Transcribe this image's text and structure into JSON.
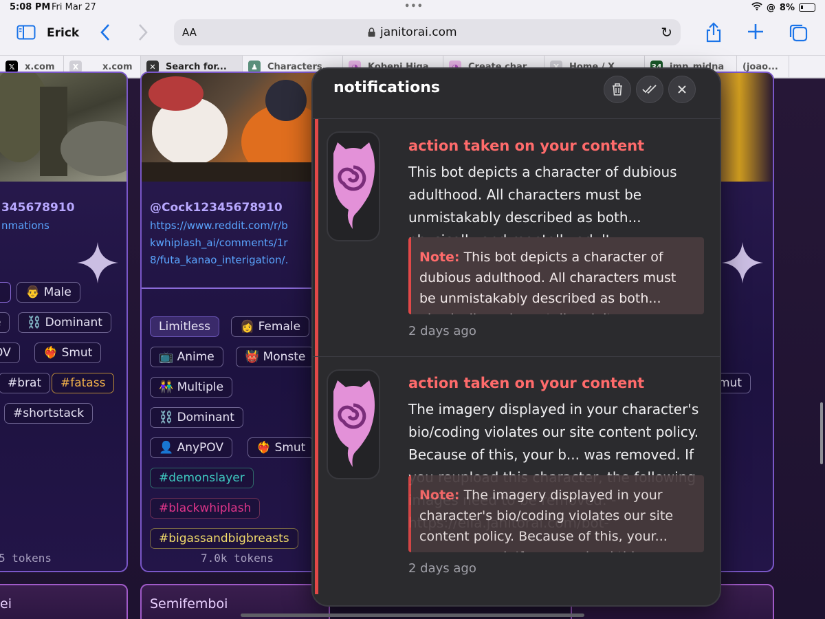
{
  "status": {
    "time": "5:08 PM",
    "date": "Fri Mar 27",
    "battery": "8%"
  },
  "toolbar": {
    "profile": "Erick",
    "text_size": "AA",
    "url": "janitorai.com"
  },
  "tabs": [
    {
      "label": "x.com",
      "icon": "x-logo-icon"
    },
    {
      "label": "x.com",
      "icon": "x-logo-icon"
    },
    {
      "label": "Search for...",
      "icon": "x-logo-icon"
    },
    {
      "label": "Characters...",
      "icon": "character-icon"
    },
    {
      "label": "Kobeni Higa...",
      "icon": "pink-blob-icon"
    },
    {
      "label": "Create char...",
      "icon": "pink-blob-icon"
    },
    {
      "label": "Home / X",
      "icon": "x-logo-icon"
    },
    {
      "label": "imp_midna",
      "icon": "34-icon"
    },
    {
      "label": "(joao...",
      "icon": ""
    }
  ],
  "cards": {
    "left": {
      "handle": "345678910",
      "link": "nmations",
      "tags": [
        "👨 Male",
        "e",
        "⛓️ Dominant",
        "OV",
        "❤️‍🔥 Smut",
        "#brat",
        "#fatass",
        "#shortstack"
      ],
      "tokens": "5 tokens",
      "bottom": "ei"
    },
    "middle": {
      "handle": "@Cock12345678910",
      "link_lines": [
        "https://www.reddit.com/r/b",
        "kwhiplash_ai/comments/1r",
        "8/futa_kanao_interigation/."
      ],
      "tags": [
        "Limitless",
        "👩 Female",
        "📺 Anime",
        "👹 Monste",
        "👫 Multiple",
        "⛓️ Dominant",
        "👤 AnyPOV",
        "❤️‍🔥 Smut",
        "#demonslayer",
        "#blackwhiplash",
        "#bigassandbigbreasts"
      ],
      "tokens": "7.0k tokens",
      "bottom": "Semifemboi"
    },
    "right": {
      "tags": [
        "mut"
      ]
    }
  },
  "notifications": {
    "title": "notifications",
    "items": [
      {
        "heading": "action taken on your content",
        "body": "This bot depicts a character of dubious adulthood. All characters must be unmistakably described as both... physically and mentally adult.",
        "note_label": "Note:",
        "note": "This bot depicts a character of dubious adulthood. All characters must be unmistakably described as both... physically and mentally adult.",
        "time": "2 days ago"
      },
      {
        "heading": "action taken on your content",
        "body": "The imagery displayed in your character's bio/coding violates our site content policy. Because of this, your b... was removed. If you reupload this character, the following images need to be removed: - https://ella.janitorai.com/bot-",
        "note_label": "Note:",
        "note": "The imagery displayed in your character's bio/coding violates our site content policy. Because of this, your... was removed. If you reupload this",
        "time": "2 days ago"
      }
    ]
  },
  "colors": {
    "accent": "#1a73e8",
    "alert": "#ff6b6b",
    "panel": "#2b2b2e"
  }
}
